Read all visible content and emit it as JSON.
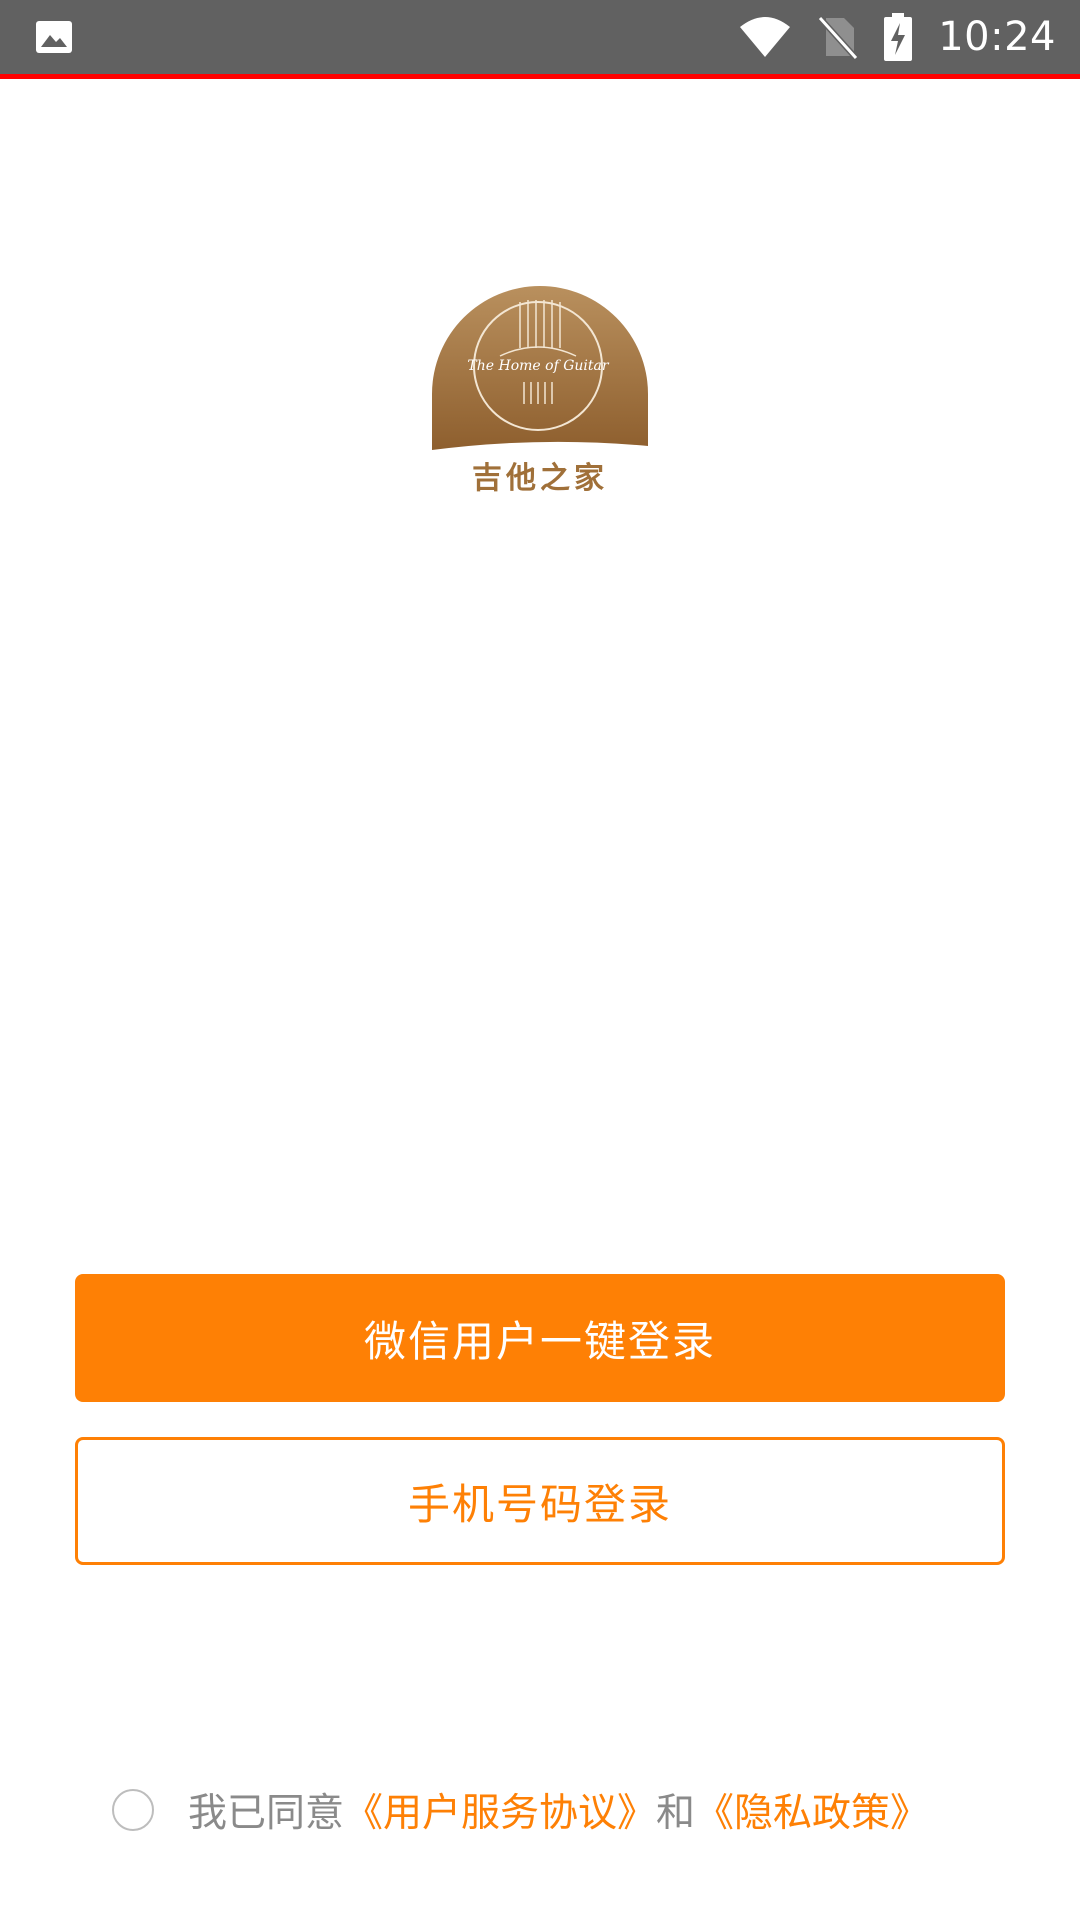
{
  "status_bar": {
    "time": "10:24",
    "icons": [
      "image-icon",
      "wifi-icon",
      "no-sim-icon",
      "battery-charging-icon"
    ]
  },
  "logo": {
    "script_text": "The Home of Guitar",
    "title_text": "吉他之家"
  },
  "buttons": {
    "wechat_login": "微信用户一键登录",
    "phone_login": "手机号码登录"
  },
  "agreement": {
    "prefix": "我已同意",
    "user_agreement": "《用户服务协议》",
    "conjunction": "和",
    "privacy_policy": "《隐私政策》",
    "checked": false
  },
  "colors": {
    "accent": "#fe8005",
    "status_bar": "#616161",
    "logo_brown": "#a07039"
  }
}
